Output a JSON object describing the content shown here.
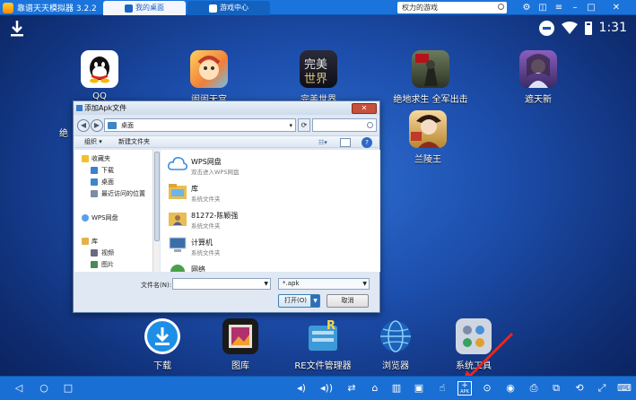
{
  "topbar": {
    "app_title": "靠谱天天模拟器 3.2.2",
    "tabs": [
      {
        "label": "我的桌面",
        "active": true
      },
      {
        "label": "游戏中心",
        "active": false
      }
    ],
    "search_text": "权力的游戏"
  },
  "status": {
    "time": "1:31"
  },
  "apps": [
    {
      "label": "QQ",
      "icon": "qq-icon"
    },
    {
      "label": "闹闹天宫",
      "icon": "naonao-tiangong-icon"
    },
    {
      "label": "完美世界",
      "icon": "wanmei-shijie-icon"
    },
    {
      "label": "绝地求生 全军出击",
      "icon": "pubg-icon"
    },
    {
      "label": "遮天新",
      "icon": "zhetian-icon"
    },
    {
      "label": "兰陵王",
      "icon": "lanlingwang-icon"
    }
  ],
  "partial_app_label": "绝",
  "dialog": {
    "title": "添加Apk文件",
    "path": "桌面",
    "commands": {
      "organize": "组织 ▾",
      "new_folder": "新建文件夹"
    },
    "nav_items": [
      {
        "label": "收藏夹",
        "indent": 0
      },
      {
        "label": "下载",
        "indent": 1
      },
      {
        "label": "桌面",
        "indent": 1
      },
      {
        "label": "最近访问的位置",
        "indent": 1
      },
      {
        "label": "WPS网盘",
        "indent": 0
      },
      {
        "label": "库",
        "indent": 0
      },
      {
        "label": "视频",
        "indent": 1
      },
      {
        "label": "图片",
        "indent": 1
      }
    ],
    "files": [
      {
        "name": "WPS网盘",
        "type": "双击进入WPS网盘"
      },
      {
        "name": "库",
        "type": "系统文件夹"
      },
      {
        "name": "81272-陈颖强",
        "type": "系统文件夹"
      },
      {
        "name": "计算机",
        "type": "系统文件夹"
      },
      {
        "name": "网络",
        "type": ""
      }
    ],
    "filename_label": "文件名(N):",
    "filename_value": "",
    "filter": "*.apk",
    "open_label": "打开(O)",
    "cancel_label": "取消"
  },
  "dock": [
    {
      "label": "下载"
    },
    {
      "label": "图库"
    },
    {
      "label": "RE文件管理器"
    },
    {
      "label": "浏览器"
    },
    {
      "label": "系统工具"
    }
  ],
  "bottom_bar": {
    "apk_label": "APK"
  },
  "colors": {
    "topbar": "#1b74dc",
    "bottombar": "#1a6fd4",
    "accent": "#1b64c4",
    "arrow": "#e8271a"
  }
}
